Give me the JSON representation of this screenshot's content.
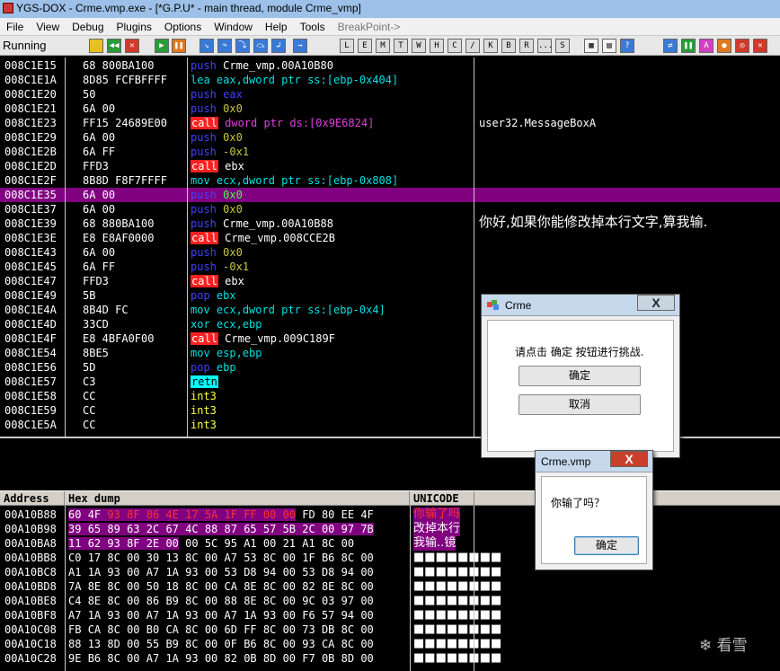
{
  "window": {
    "title": "YGS-DOX - Crme.vmp.exe - [*G.P.U* - main thread, module Crme_vmp]"
  },
  "menu": [
    {
      "label": "File"
    },
    {
      "label": "View"
    },
    {
      "label": "Debug"
    },
    {
      "label": "Plugins"
    },
    {
      "label": "Options"
    },
    {
      "label": "Window"
    },
    {
      "label": "Help"
    },
    {
      "label": "Tools"
    },
    {
      "label": "BreakPoint->"
    }
  ],
  "toolbar": {
    "status": "Running",
    "letters": [
      "L",
      "E",
      "M",
      "T",
      "W",
      "H",
      "C",
      "/",
      "K",
      "B",
      "R",
      "...",
      "S"
    ]
  },
  "disasm": [
    {
      "addr": "008C1E15",
      "hex": "68 800BA100",
      "mn": "push",
      "ops": "Crme_vmp.00A10B80",
      "k": "push",
      "o": "op-fg"
    },
    {
      "addr": "008C1E1A",
      "hex": "8D85 FCFBFFFF",
      "mn": "lea",
      "ops": "eax,dword ptr ss:[ebp-0x404]",
      "k": "lea",
      "o": "op-mem"
    },
    {
      "addr": "008C1E20",
      "hex": "50",
      "mn": "push",
      "ops": "eax",
      "k": "push",
      "o": "op-push"
    },
    {
      "addr": "008C1E21",
      "hex": "6A 00",
      "mn": "push",
      "ops": "0x0",
      "k": "push",
      "o": "op-imm"
    },
    {
      "addr": "008C1E23",
      "hex": "FF15 24689E00",
      "mn": "call",
      "ops": "dword ptr ds:[0x9E6824]",
      "k": "call",
      "o": "op-dsm",
      "cmt": "user32.MessageBoxA"
    },
    {
      "addr": "008C1E29",
      "hex": "6A 00",
      "mn": "push",
      "ops": "0x0",
      "k": "push",
      "o": "op-imm"
    },
    {
      "addr": "008C1E2B",
      "hex": "6A FF",
      "mn": "push",
      "ops": "-0x1",
      "k": "push",
      "o": "op-imm"
    },
    {
      "addr": "008C1E2D",
      "hex": "FFD3",
      "mn": "call",
      "ops": "ebx",
      "k": "call",
      "o": "op-fg"
    },
    {
      "addr": "008C1E2F",
      "hex": "8B8D F8F7FFFF",
      "mn": "mov",
      "ops": "ecx,dword ptr ss:[ebp-0x808]",
      "k": "mov",
      "o": "op-mem"
    },
    {
      "addr": "008C1E35",
      "hex": "6A 00",
      "mn": "push",
      "ops": "0x0",
      "k": "push",
      "o": "op-sel",
      "sel": true
    },
    {
      "addr": "008C1E37",
      "hex": "6A 00",
      "mn": "push",
      "ops": "0x0",
      "k": "push",
      "o": "op-imm"
    },
    {
      "addr": "008C1E39",
      "hex": "68 880BA100",
      "mn": "push",
      "ops": "Crme_vmp.00A10B88",
      "k": "push",
      "o": "op-fg",
      "cmtcn": "你好,如果你能修改掉本行文字,算我输."
    },
    {
      "addr": "008C1E3E",
      "hex": "E8 E8AF0000",
      "mn": "call",
      "ops": "Crme_vmp.008CCE2B",
      "k": "call",
      "o": "op-fg"
    },
    {
      "addr": "008C1E43",
      "hex": "6A 00",
      "mn": "push",
      "ops": "0x0",
      "k": "push",
      "o": "op-imm"
    },
    {
      "addr": "008C1E45",
      "hex": "6A FF",
      "mn": "push",
      "ops": "-0x1",
      "k": "push",
      "o": "op-imm"
    },
    {
      "addr": "008C1E47",
      "hex": "FFD3",
      "mn": "call",
      "ops": "ebx",
      "k": "call",
      "o": "op-fg"
    },
    {
      "addr": "008C1E49",
      "hex": "5B",
      "mn": "pop",
      "ops": "ebx",
      "k": "pop",
      "o": "op-mem"
    },
    {
      "addr": "008C1E4A",
      "hex": "8B4D FC",
      "mn": "mov",
      "ops": "ecx,dword ptr ss:[ebp-0x4]",
      "k": "mov",
      "o": "op-mem"
    },
    {
      "addr": "008C1E4D",
      "hex": "33CD",
      "mn": "xor",
      "ops": "ecx,ebp",
      "k": "xor",
      "o": "op-mem"
    },
    {
      "addr": "008C1E4F",
      "hex": "E8 4BFA0F00",
      "mn": "call",
      "ops": "Crme_vmp.009C189F",
      "k": "call",
      "o": "op-fg"
    },
    {
      "addr": "008C1E54",
      "hex": "8BE5",
      "mn": "mov",
      "ops": "esp,ebp",
      "k": "mov",
      "o": "op-mem"
    },
    {
      "addr": "008C1E56",
      "hex": "5D",
      "mn": "pop",
      "ops": "ebp",
      "k": "pop",
      "o": "op-mem"
    },
    {
      "addr": "008C1E57",
      "hex": "C3",
      "mn": "retn",
      "ops": "",
      "k": "retn",
      "o": "op-fg"
    },
    {
      "addr": "008C1E58",
      "hex": "CC",
      "mn": "int3",
      "ops": "",
      "k": "int",
      "o": "op-fg"
    },
    {
      "addr": "008C1E59",
      "hex": "CC",
      "mn": "int3",
      "ops": "",
      "k": "int",
      "o": "op-fg"
    },
    {
      "addr": "008C1E5A",
      "hex": "CC",
      "mn": "int3",
      "ops": "",
      "k": "int",
      "o": "op-fg"
    }
  ],
  "dump_header": {
    "address": "Address",
    "hex": "Hex dump",
    "unicode": "UNICODE"
  },
  "dump": [
    {
      "addr": "00A10B88",
      "b": [
        "60",
        "4F",
        "93",
        "8F",
        "86",
        "4E",
        "17",
        "5A",
        "1F",
        "FF",
        "00",
        "00",
        "FD",
        "80",
        "EE",
        "4F"
      ],
      "hl": [
        0,
        12
      ],
      "red": [
        2,
        3,
        4,
        5,
        6,
        7,
        8,
        9,
        10,
        11
      ],
      "u": "你输了吗"
    },
    {
      "addr": "00A10B98",
      "b": [
        "39",
        "65",
        "89",
        "63",
        "2C",
        "67",
        "4C",
        "88",
        "87",
        "65",
        "57",
        "5B",
        "2C",
        "00",
        "97",
        "7B"
      ],
      "hl": [
        0,
        16
      ],
      "red": [],
      "u": "改掉本行"
    },
    {
      "addr": "00A10BA8",
      "b": [
        "11",
        "62",
        "93",
        "8F",
        "2E",
        "00",
        "00",
        "5C",
        "95",
        "A1",
        "00",
        "21",
        "A1",
        "8C",
        "00"
      ],
      "hl": [
        0,
        6
      ],
      "red": [],
      "u": "我输..镜"
    },
    {
      "addr": "00A10BB8",
      "b": [
        "C0",
        "17",
        "8C",
        "00",
        "30",
        "13",
        "8C",
        "00",
        "A7",
        "53",
        "8C",
        "00",
        "1F",
        "B6",
        "8C",
        "00"
      ],
      "hl": [],
      "red": [],
      "u": "■■■■■■■■"
    },
    {
      "addr": "00A10BC8",
      "b": [
        "A1",
        "1A",
        "93",
        "00",
        "A7",
        "1A",
        "93",
        "00",
        "53",
        "D8",
        "94",
        "00",
        "53",
        "D8",
        "94",
        "00"
      ],
      "hl": [],
      "red": [],
      "u": "■■■■■■■■"
    },
    {
      "addr": "00A10BD8",
      "b": [
        "7A",
        "8E",
        "8C",
        "00",
        "50",
        "18",
        "8C",
        "00",
        "CA",
        "8E",
        "8C",
        "00",
        "82",
        "8E",
        "8C",
        "00"
      ],
      "hl": [],
      "red": [],
      "u": "■■■■■■■■"
    },
    {
      "addr": "00A10BE8",
      "b": [
        "C4",
        "8E",
        "8C",
        "00",
        "86",
        "B9",
        "8C",
        "00",
        "88",
        "8E",
        "8C",
        "00",
        "9C",
        "03",
        "97",
        "00"
      ],
      "hl": [],
      "red": [],
      "u": "■■■■■■■■"
    },
    {
      "addr": "00A10BF8",
      "b": [
        "A7",
        "1A",
        "93",
        "00",
        "A7",
        "1A",
        "93",
        "00",
        "A7",
        "1A",
        "93",
        "00",
        "F6",
        "57",
        "94",
        "00"
      ],
      "hl": [],
      "red": [],
      "u": "■■■■■■■■"
    },
    {
      "addr": "00A10C08",
      "b": [
        "FB",
        "CA",
        "8C",
        "00",
        "B0",
        "CA",
        "8C",
        "00",
        "6D",
        "FF",
        "8C",
        "00",
        "73",
        "DB",
        "8C",
        "00"
      ],
      "hl": [],
      "red": [],
      "u": "■■■■■■■■"
    },
    {
      "addr": "00A10C18",
      "b": [
        "88",
        "13",
        "8D",
        "00",
        "55",
        "B9",
        "8C",
        "00",
        "0F",
        "B6",
        "8C",
        "00",
        "93",
        "CA",
        "8C",
        "00"
      ],
      "hl": [],
      "red": [],
      "u": "■■■■■■■■"
    },
    {
      "addr": "00A10C28",
      "b": [
        "9E",
        "B6",
        "8C",
        "00",
        "A7",
        "1A",
        "93",
        "00",
        "82",
        "0B",
        "8D",
        "00",
        "F7",
        "0B",
        "8D",
        "00"
      ],
      "hl": [],
      "red": [],
      "u": "■■■■■■■■"
    }
  ],
  "dialog1": {
    "title": "Crme",
    "message": "请点击 确定 按钮进行挑战.",
    "ok": "确定",
    "cancel": "取消",
    "close": "X"
  },
  "dialog2": {
    "title": "Crme.vmp",
    "message": "你输了吗？",
    "ok": "确定",
    "close": "X"
  },
  "watermark": "看雪"
}
